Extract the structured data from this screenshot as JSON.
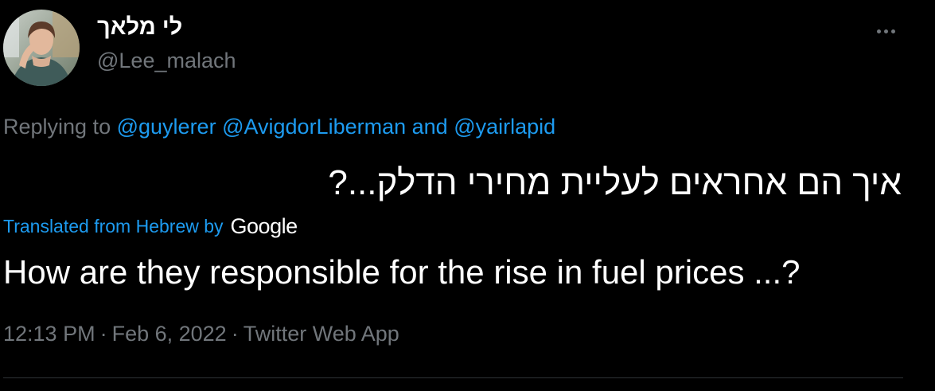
{
  "author": {
    "display_name": "לי מלאך",
    "handle": "@Lee_malach"
  },
  "reply_context": {
    "prefix": "Replying to",
    "mention_1": "@guylerer",
    "mention_2": "@AvigdorLiberman",
    "conjunction": "and",
    "mention_3": "@yairlapid"
  },
  "tweet": {
    "original_text": "איך הם אחראים לעליית מחירי הדלק...?",
    "translated_by_label": "Translated from Hebrew by",
    "translator": "Google",
    "translated_text": "How are they responsible for the rise in fuel prices ...?"
  },
  "meta": {
    "time": "12:13 PM",
    "separator": "·",
    "date": "Feb 6, 2022",
    "source": "Twitter Web App"
  },
  "icons": {
    "more": "more-horizontal-icon"
  },
  "colors": {
    "background": "#000000",
    "text_primary": "#ffffff",
    "text_secondary": "#71767b",
    "link": "#1d9bf0",
    "divider": "#2f3336"
  }
}
